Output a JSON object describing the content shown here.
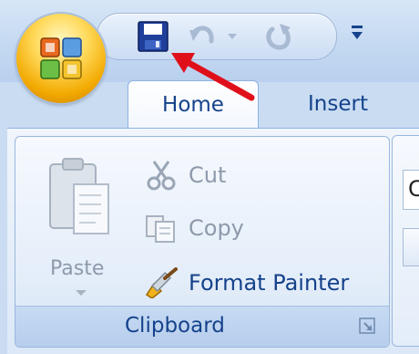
{
  "tabs": {
    "home": "Home",
    "insert": "Insert"
  },
  "clipboard": {
    "paste_label": "Paste",
    "cut_label": "Cut",
    "copy_label": "Copy",
    "format_painter_label": "Format Painter",
    "group_title": "Clipboard"
  },
  "next_group": {
    "visible_char": "C"
  },
  "icons": {
    "office_button": "office-logo-icon",
    "save": "save-icon",
    "undo": "undo-icon",
    "redo": "redo-icon",
    "customize": "customize-qat-icon"
  },
  "colors": {
    "accent": "#15428b",
    "disabled": "#8e9aab",
    "arrow": "#e0101a"
  }
}
